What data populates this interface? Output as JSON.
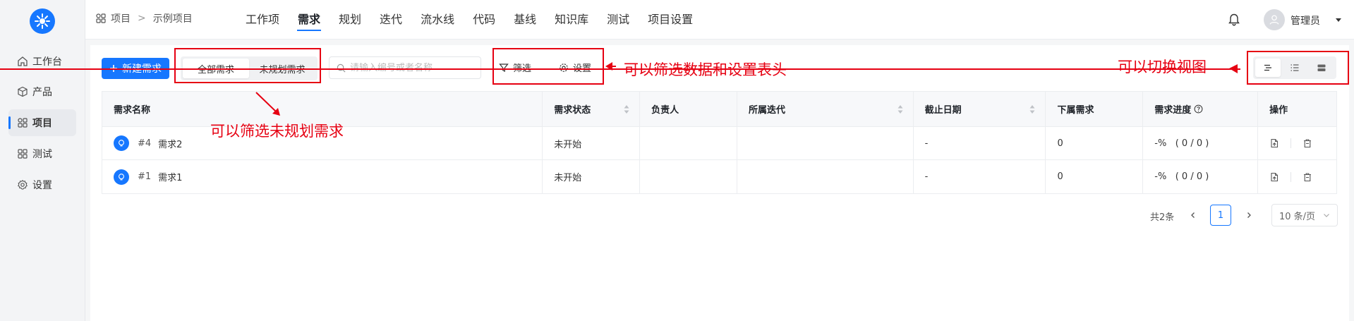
{
  "sidebar": {
    "items": [
      {
        "label": "工作台",
        "icon": "home-icon"
      },
      {
        "label": "产品",
        "icon": "cube-icon"
      },
      {
        "label": "项目",
        "icon": "grid-icon",
        "active": true
      },
      {
        "label": "测试",
        "icon": "grid-icon"
      },
      {
        "label": "设置",
        "icon": "gear-icon"
      }
    ]
  },
  "header": {
    "breadcrumb": {
      "root": "项目",
      "separator": ">",
      "current": "示例项目"
    },
    "tabs": [
      "工作项",
      "需求",
      "规划",
      "迭代",
      "流水线",
      "代码",
      "基线",
      "知识库",
      "测试",
      "项目设置"
    ],
    "active_tab": "需求",
    "user_name": "管理员"
  },
  "toolbar": {
    "new_button": "新建需求",
    "segments": [
      "全部需求",
      "未规划需求"
    ],
    "search_placeholder": "请输入编号或者名称",
    "filter_label": "筛选",
    "settings_label": "设置"
  },
  "table": {
    "headers": [
      "需求名称",
      "需求状态",
      "负责人",
      "所属迭代",
      "截止日期",
      "下属需求",
      "需求进度",
      "操作"
    ],
    "rows": [
      {
        "code": "#4",
        "name": "需求2",
        "status": "未开始",
        "owner": "",
        "iteration": "",
        "due": "-",
        "children": "0",
        "progress": "-%   ( 0 / 0 )"
      },
      {
        "code": "#1",
        "name": "需求1",
        "status": "未开始",
        "owner": "",
        "iteration": "",
        "due": "-",
        "children": "0",
        "progress": "-%   ( 0 / 0 )"
      }
    ]
  },
  "pagination": {
    "total": "共2条",
    "current_page": "1",
    "page_size": "10 条/页"
  },
  "annotations": {
    "unplanned_note": "可以筛选未规划需求",
    "filter_note": "可以筛选数据和设置表头",
    "view_note": "可以切换视图"
  },
  "colors": {
    "accent": "#1677ff",
    "annotation": "#e60012"
  }
}
